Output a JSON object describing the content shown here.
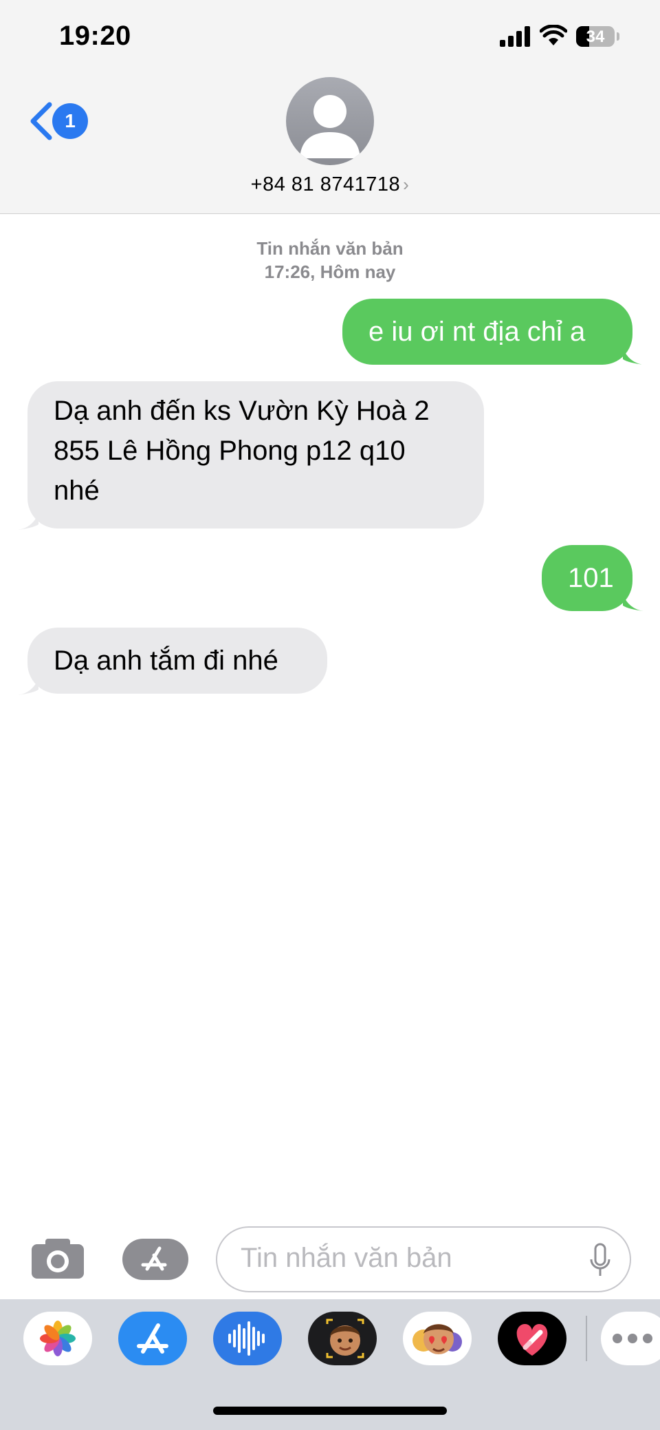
{
  "status_bar": {
    "time": "19:20",
    "battery_level": "34"
  },
  "header": {
    "unread_count": "1",
    "contact": "+84 81 8741718",
    "contact_chevron": "›"
  },
  "thread": {
    "service_label": "Tin nhắn văn bản",
    "timestamp": "17:26, Hôm nay",
    "messages": [
      {
        "direction": "outgoing",
        "text": "e iu ơi nt địa chỉ a"
      },
      {
        "direction": "incoming",
        "lines": [
          "Dạ anh đến ks Vườn Kỳ Hoà 2",
          "855 Lê Hồng Phong p12 q10",
          "nhé"
        ]
      },
      {
        "direction": "outgoing",
        "text": "101"
      },
      {
        "direction": "incoming",
        "text": "Dạ anh tắm đi nhé"
      }
    ]
  },
  "compose": {
    "placeholder": "Tin nhắn văn bản"
  },
  "app_drawer": [
    "photos-icon",
    "app-store-icon",
    "audio-message-icon",
    "memoji-icon",
    "memoji-stickers-icon",
    "digital-touch-icon",
    "more-icon"
  ],
  "colors": {
    "outgoing_bubble": "#5ac95e",
    "incoming_bubble": "#e9e9eb",
    "badge": "#2a79f0",
    "back_chevron": "#2a79f0"
  }
}
